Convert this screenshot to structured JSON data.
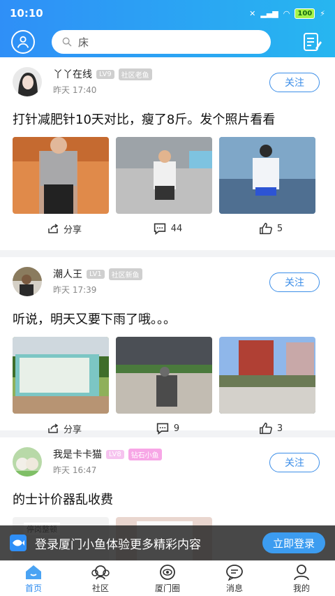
{
  "status": {
    "time": "10:10",
    "battery": "100"
  },
  "search": {
    "query": "床"
  },
  "posts": [
    {
      "author": "丫丫在线",
      "level": "LV9",
      "tag": "社区老鱼",
      "time": "昨天 17:40",
      "follow": "关注",
      "text": "打针减肥针10天对比，瘦了8斤。发个照片看看",
      "share": "分享",
      "comments": "44",
      "likes": "5"
    },
    {
      "author": "潮人王",
      "level": "LV1",
      "tag": "社区新鱼",
      "time": "昨天 17:39",
      "follow": "关注",
      "text": "听说，明天又要下雨了哦。。。",
      "share": "分享",
      "comments": "9",
      "likes": "3"
    },
    {
      "author": "我是卡卡猫",
      "level": "LV8",
      "tag": "钻石小鱼",
      "time": "昨天 16:47",
      "follow": "关注",
      "text": "的士计价器乱收费",
      "img1_caption": "停岗整顿"
    }
  ],
  "banner": {
    "text": "登录厦门小鱼体验更多精彩内容",
    "button": "立即登录"
  },
  "tabs": [
    {
      "label": "首页",
      "icon": "home-icon"
    },
    {
      "label": "社区",
      "icon": "community-icon"
    },
    {
      "label": "厦门圈",
      "icon": "circle-icon"
    },
    {
      "label": "消息",
      "icon": "message-icon"
    },
    {
      "label": "我的",
      "icon": "profile-icon"
    }
  ],
  "colors": {
    "primary": "#2d8cf0",
    "header_gradient_start": "#2f8ff7",
    "header_gradient_end": "#27b6f0"
  }
}
